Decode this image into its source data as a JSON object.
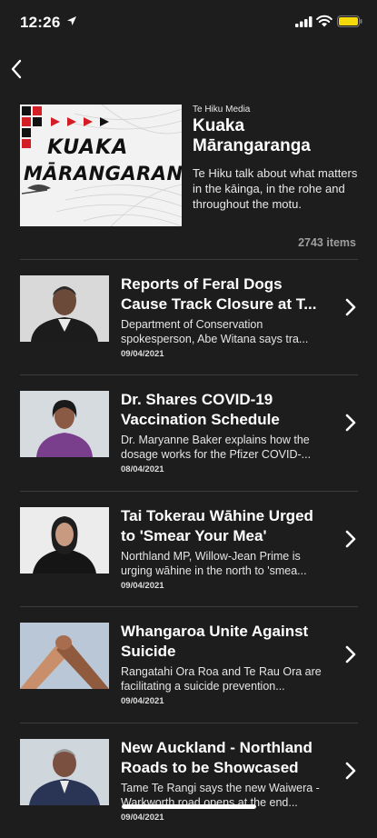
{
  "status": {
    "time": "12:26"
  },
  "podcast": {
    "publisher": "Te Hiku Media",
    "title": "Kuaka Mārangaranga",
    "description": "Te Hiku talk about what matters in the kāinga, in the rohe and throughout the motu.",
    "items_count": "2743 items",
    "cover_line1": "KUAKA",
    "cover_line2": "MĀRANGARANGA"
  },
  "episodes": [
    {
      "title": "Reports of Feral Dogs Cause Track Closure at T...",
      "description": "Department of Conservation spokesperson, Abe Witana says tra...",
      "date": "09/04/2021"
    },
    {
      "title": "Dr. Shares COVID-19 Vaccination Schedule",
      "description": "Dr. Maryanne Baker explains how the dosage works for the Pfizer COVID-...",
      "date": "08/04/2021"
    },
    {
      "title": "Tai Tokerau Wāhine Urged to 'Smear Your Mea'",
      "description": "Northland MP, Willow-Jean Prime is urging wāhine in the north to 'smea...",
      "date": "09/04/2021"
    },
    {
      "title": "Whangaroa Unite Against Suicide",
      "description": "Rangatahi Ora Roa and Te Rau Ora are facilitating a suicide prevention...",
      "date": "09/04/2021"
    },
    {
      "title": "New Auckland - Northland Roads to be Showcased",
      "description": "Tame Te Rangi says the new Waiwera - Warkworth road opens at the end...",
      "date": "09/04/2021"
    }
  ],
  "colors": {
    "background": "#1d1d1d",
    "battery": "#f5d90a",
    "divider": "#3c3c3c"
  },
  "icons": [
    "location-arrow-icon",
    "signal-icon",
    "wifi-icon",
    "battery-icon",
    "back-chevron-icon",
    "chevron-right-icon"
  ]
}
